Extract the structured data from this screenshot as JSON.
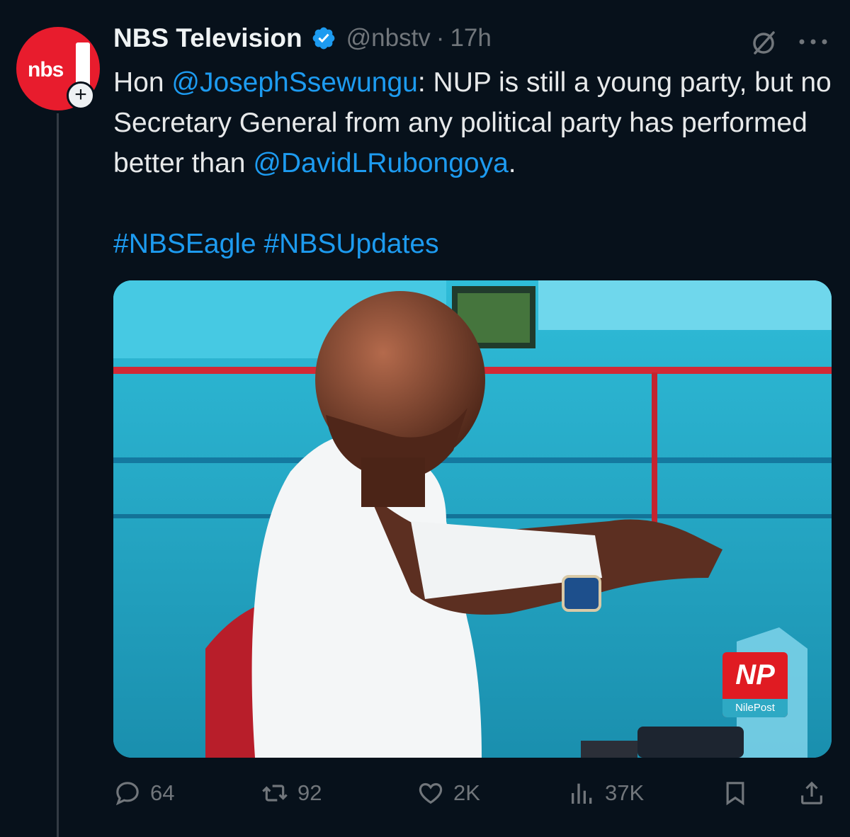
{
  "tweet": {
    "author": {
      "display_name": "NBS Television",
      "handle": "@nbstv",
      "separator": "·",
      "time": "17h",
      "avatar_text": "nbs",
      "follow_icon": "plus-icon",
      "verified_icon": "verified-badge-icon",
      "verified_color": "#1d9bf0"
    },
    "text": {
      "prefix": "Hon ",
      "mention_1": "@JosephSsewungu",
      "middle": ": NUP is still a young party, but no Secretary General from any political party has performed better than ",
      "mention_2": "@DavidLRubongoya",
      "suffix": "."
    },
    "hashtags": [
      "#NBSEagle",
      "#NBSUpdates"
    ],
    "media": {
      "watermark_logo_letters": "NP",
      "watermark_logo_name": "NilePost"
    },
    "actions": {
      "replies": "64",
      "reposts": "92",
      "likes": "2K",
      "views": "37K"
    },
    "icons": {
      "grok": "grok-icon",
      "more": "more-dots-icon",
      "reply": "reply-icon",
      "repost": "repost-icon",
      "like": "heart-icon",
      "views": "analytics-icon",
      "bookmark": "bookmark-icon",
      "share": "share-icon"
    },
    "colors": {
      "background": "#07111b",
      "link": "#1d9bf0",
      "muted": "#71767b",
      "text": "#e7e9ea"
    }
  }
}
